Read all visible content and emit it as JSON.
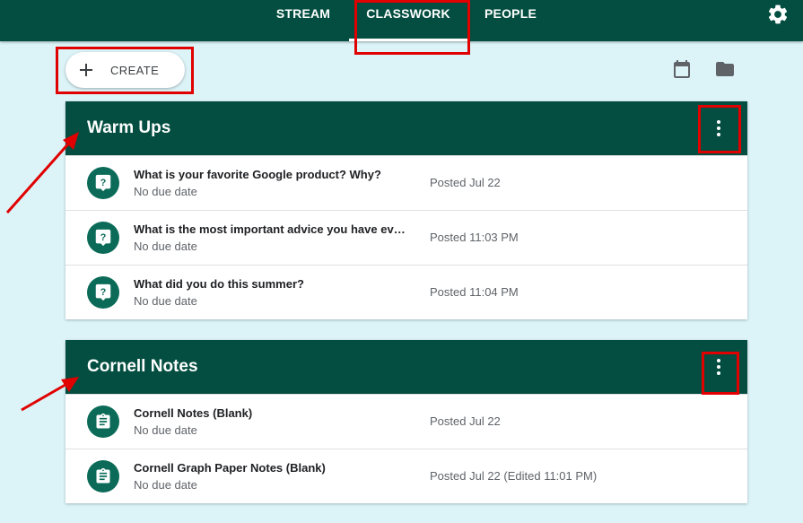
{
  "nav": {
    "tabs": [
      {
        "label": "STREAM"
      },
      {
        "label": "CLASSWORK"
      },
      {
        "label": "PEOPLE"
      }
    ],
    "active_tab": "CLASSWORK",
    "settings_icon": "gear-icon"
  },
  "toolbar": {
    "create_label": "CREATE",
    "calendar_icon": "calendar-icon",
    "folder_icon": "folder-icon"
  },
  "topics": [
    {
      "title": "Warm Ups",
      "items": [
        {
          "title": "What is your favorite Google product? Why?",
          "due": "No due date",
          "posted": "Posted Jul 22",
          "icon": "question-icon"
        },
        {
          "title": "What is the most important advice you have ever r...",
          "due": "No due date",
          "posted": "Posted 11:03 PM",
          "icon": "question-icon"
        },
        {
          "title": "What did you do this summer?",
          "due": "No due date",
          "posted": "Posted 11:04 PM",
          "icon": "question-icon"
        }
      ]
    },
    {
      "title": "Cornell Notes",
      "items": [
        {
          "title": "Cornell Notes (Blank)",
          "due": "No due date",
          "posted": "Posted Jul 22",
          "icon": "assignment-icon"
        },
        {
          "title": "Cornell Graph Paper Notes (Blank)",
          "due": "No due date",
          "posted": "Posted Jul 22 (Edited 11:01 PM)",
          "icon": "assignment-icon"
        }
      ]
    }
  ],
  "colors": {
    "header_green": "#034e40",
    "icon_green": "#0b6b58",
    "background": "#dcf4f8",
    "annotation_red": "#e00000"
  }
}
